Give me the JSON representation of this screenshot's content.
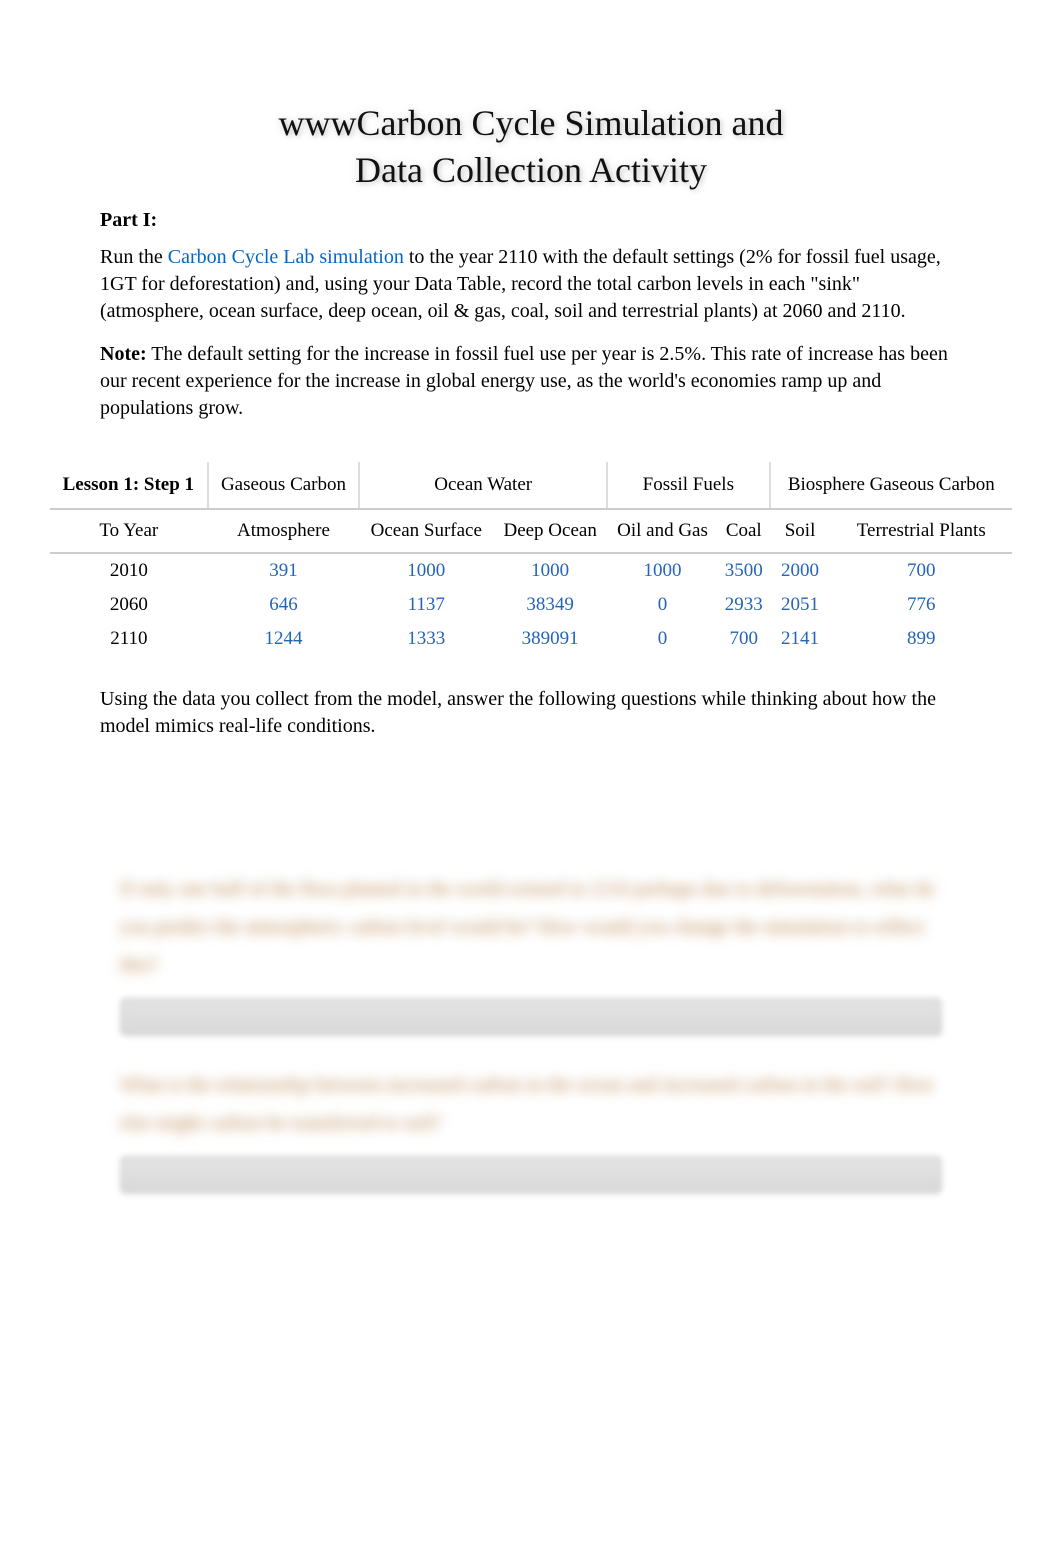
{
  "title_line1": "wwwCarbon Cycle Simulation and",
  "title_line2": "Data Collection Activity",
  "part_label": "Part I:",
  "intro": {
    "run_text_before": "Run the ",
    "link_text": "Carbon Cycle Lab simulation",
    "run_text_after": " to the year 2110 with the default settings (2% for fossil fuel usage, 1GT for deforestation) and, using your Data Table, record the total carbon levels in each \"sink\" (atmosphere, ocean surface, deep ocean, oil & gas, coal, soil and terrestrial plants) at 2060 and 2110."
  },
  "note": {
    "label": "Note:",
    "text": " The default setting for the increase in fossil fuel use per year is 2.5%. This rate of increase has been our recent experience for the increase in global energy use, as the world's economies ramp up and populations grow."
  },
  "table": {
    "corner": "Lesson 1: Step 1",
    "groups": [
      "Gaseous Carbon",
      "Ocean Water",
      "Fossil Fuels",
      "Biosphere Gaseous Carbon"
    ],
    "sub_headers": [
      "To Year",
      "Atmosphere",
      "Ocean Surface",
      "Deep Ocean",
      "Oil and Gas",
      "Coal",
      "Soil",
      "Terrestrial Plants"
    ],
    "rows": [
      {
        "year": "2010",
        "vals": [
          "391",
          "1000",
          "1000",
          "1000",
          "3500",
          "2000",
          "700"
        ]
      },
      {
        "year": "2060",
        "vals": [
          "646",
          "1137",
          "38349",
          "0",
          "2933",
          "2051",
          "776"
        ]
      },
      {
        "year": "2110",
        "vals": [
          "1244",
          "1333",
          "389091",
          "0",
          "700",
          "2141",
          "899"
        ]
      }
    ]
  },
  "below_table": "Using the data you collect from the model, answer the following questions while thinking about how the model mimics real-life conditions.",
  "questions": {
    "q1": "If only one half of the flora planted in the world existed in 2110 perhaps due to deforestation, what do you predict the atmospheric carbon level would be? How would you change the simulation to reflect this?",
    "q2": "What is the relationship between increased carbon in the ocean and increased carbon in the soil? How else might carbon be transferred to soil?"
  }
}
